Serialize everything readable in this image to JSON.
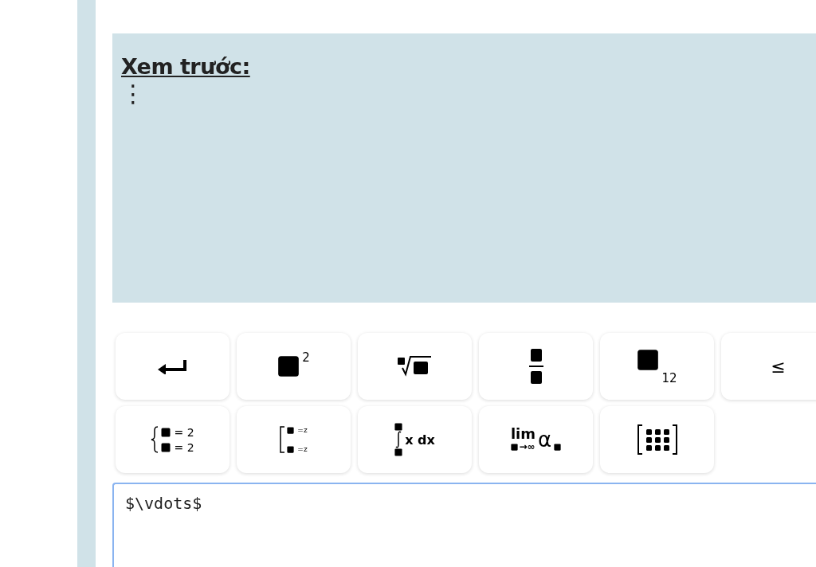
{
  "preview": {
    "title": "Xem trước:",
    "content": "⋮"
  },
  "toolbar": [
    {
      "kind": "enter"
    },
    {
      "kind": "superscript",
      "text": "2"
    },
    {
      "kind": "root"
    },
    {
      "kind": "fraction"
    },
    {
      "kind": "subscript",
      "text": "12"
    },
    {
      "kind": "symbol",
      "text": "≤"
    },
    {
      "kind": "system",
      "lines": [
        "= 2",
        "= 2"
      ]
    },
    {
      "kind": "bracket",
      "lines": [
        "=z",
        "=z"
      ]
    },
    {
      "kind": "integral",
      "text": "x dx"
    },
    {
      "kind": "limit",
      "text": "lim",
      "sub": "→∞",
      "symbol": "α"
    },
    {
      "kind": "matrix"
    }
  ],
  "editor": {
    "value": "$\\vdots$",
    "focused": true
  }
}
